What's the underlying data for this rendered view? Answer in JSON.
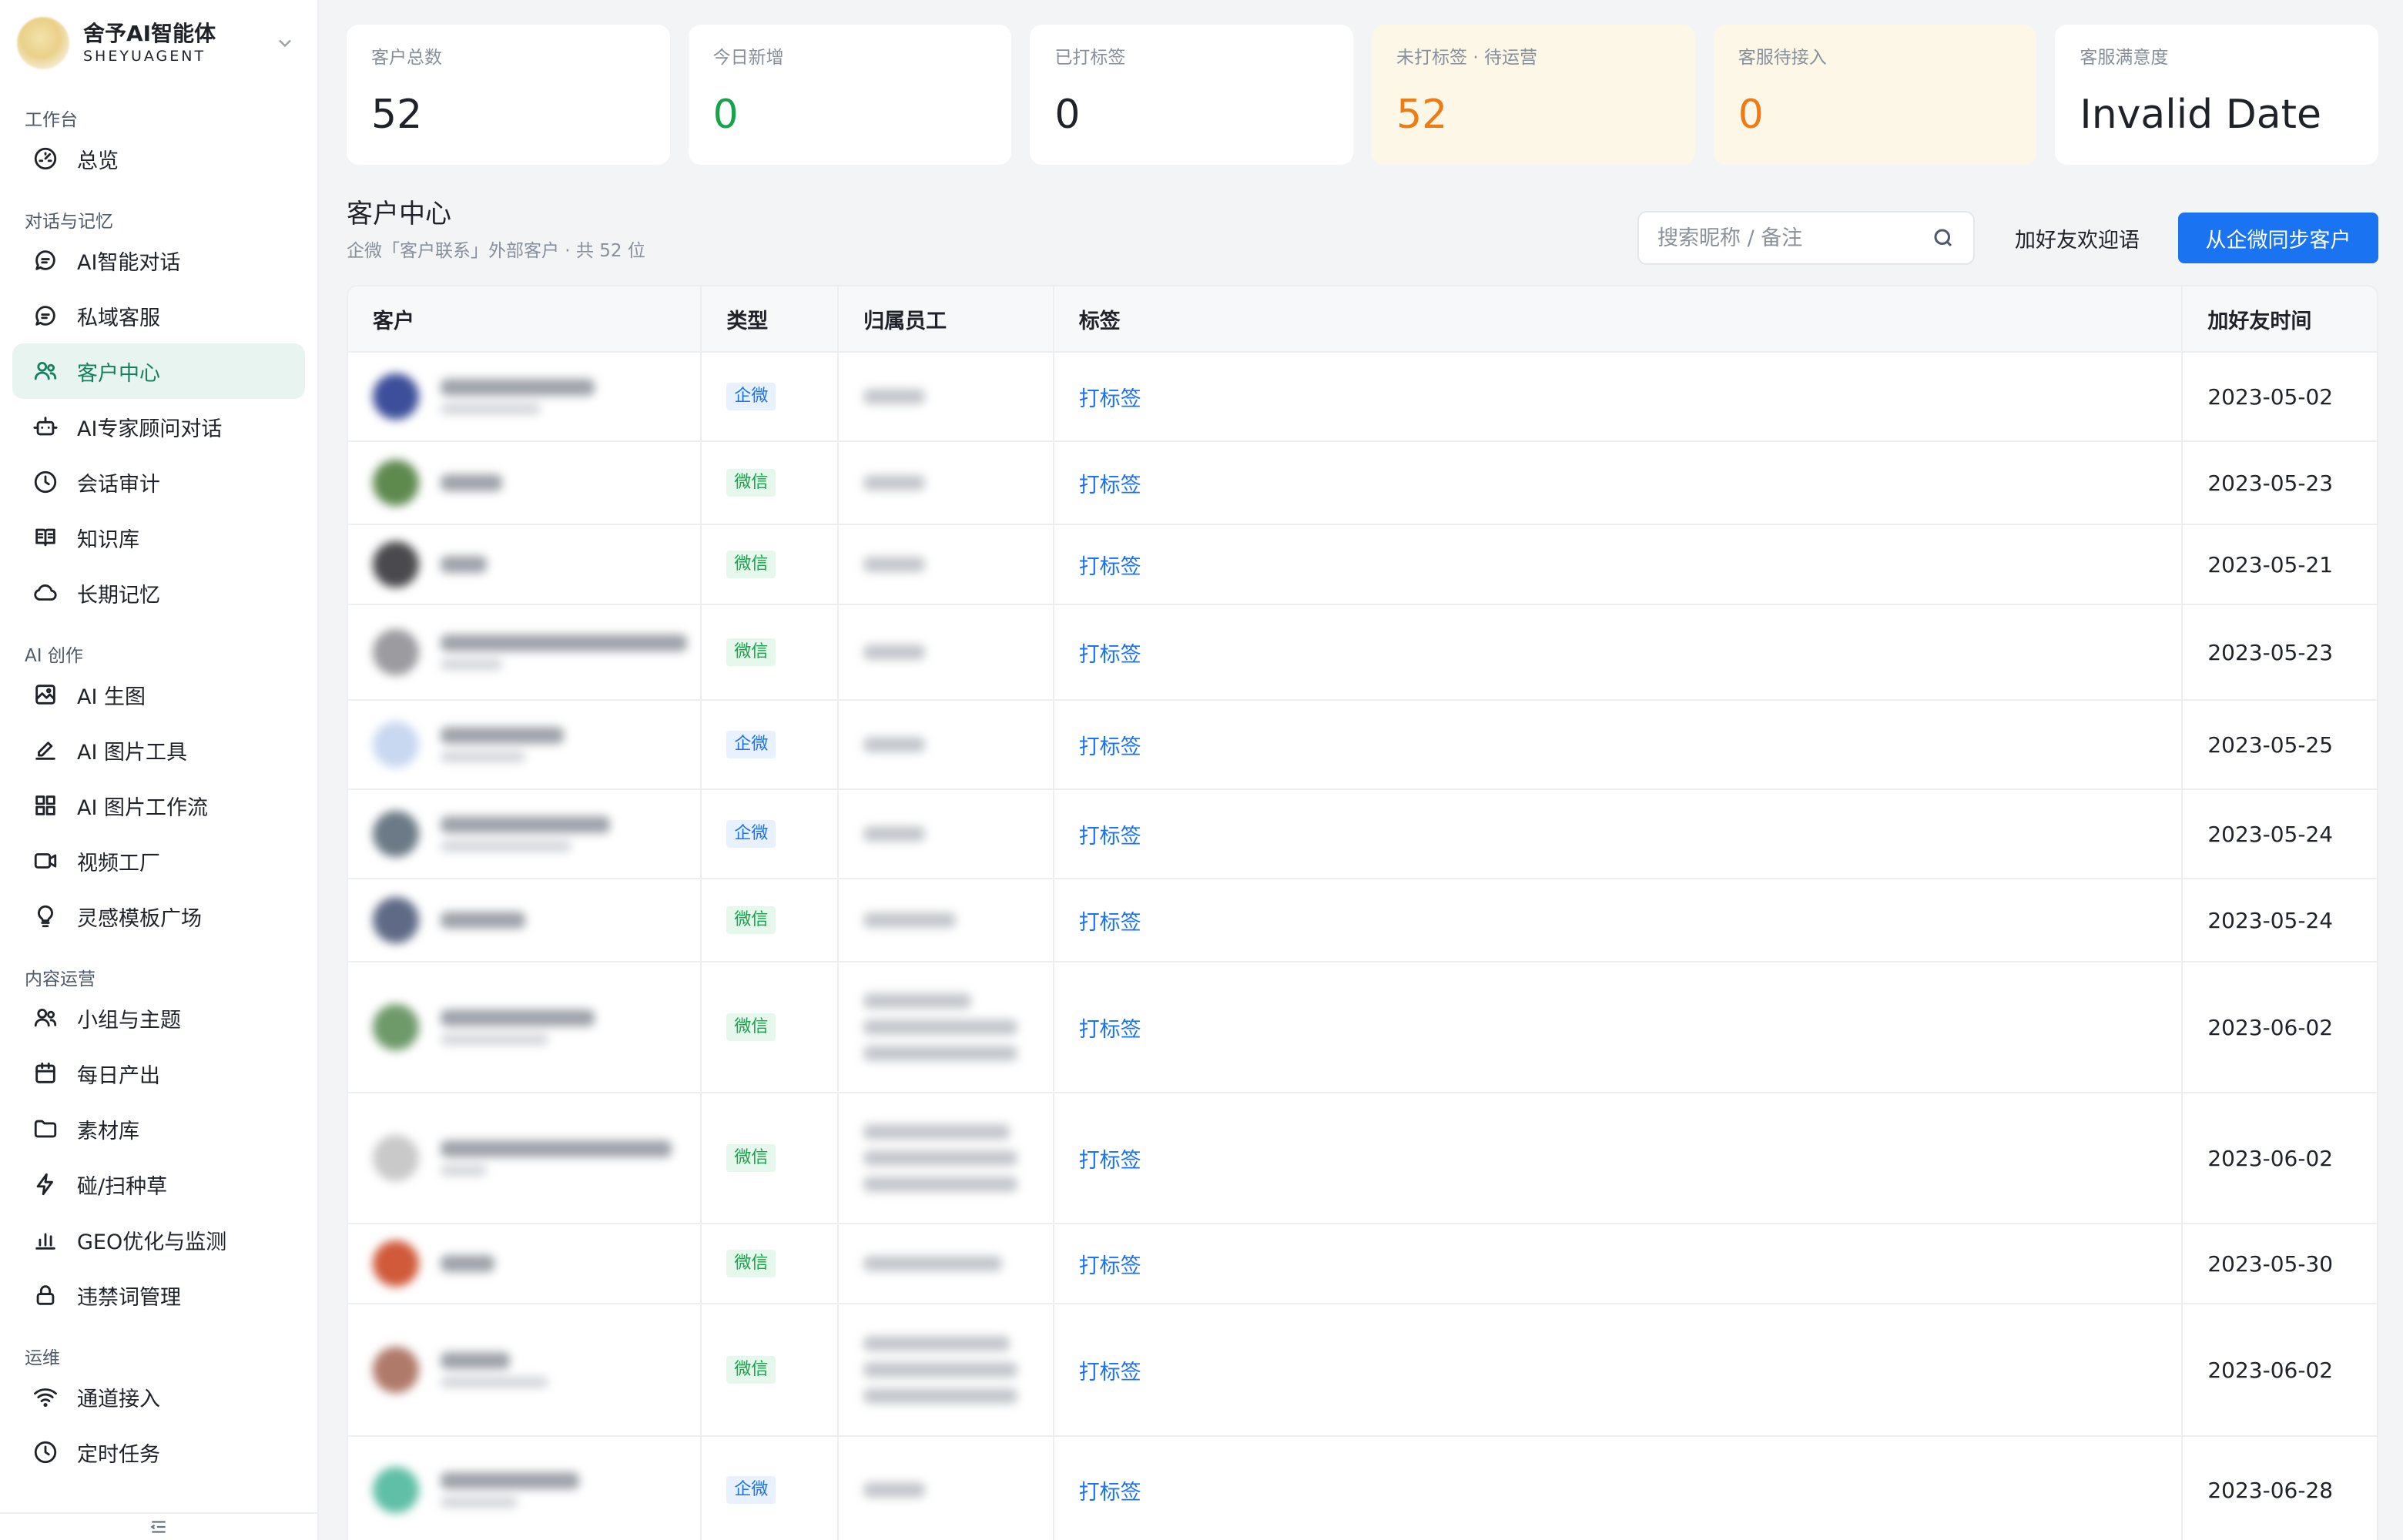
{
  "brand": {
    "name": "舍予AI智能体",
    "sub": "SHEYUAGENT",
    "chevron_icon": "chevron-down-icon"
  },
  "sidebar": {
    "sections": [
      {
        "title": "工作台",
        "items": [
          {
            "label": "总览",
            "icon": "dashboard-icon"
          }
        ]
      },
      {
        "title": "对话与记忆",
        "items": [
          {
            "label": "AI智能对话",
            "icon": "chat-icon"
          },
          {
            "label": "私域客服",
            "icon": "chat-icon"
          },
          {
            "label": "客户中心",
            "icon": "users-icon",
            "active": true
          },
          {
            "label": "AI专家顾问对话",
            "icon": "bot-icon"
          },
          {
            "label": "会话审计",
            "icon": "history-icon"
          },
          {
            "label": "知识库",
            "icon": "book-icon"
          },
          {
            "label": "长期记忆",
            "icon": "cloud-icon"
          }
        ]
      },
      {
        "title": "AI 创作",
        "items": [
          {
            "label": "AI 生图",
            "icon": "image-icon"
          },
          {
            "label": "AI 图片工具",
            "icon": "edit-icon"
          },
          {
            "label": "AI 图片工作流",
            "icon": "grid-icon"
          },
          {
            "label": "视频工厂",
            "icon": "video-icon"
          },
          {
            "label": "灵感模板广场",
            "icon": "bulb-icon"
          }
        ]
      },
      {
        "title": "内容运营",
        "items": [
          {
            "label": "小组与主题",
            "icon": "users-icon"
          },
          {
            "label": "每日产出",
            "icon": "calendar-icon"
          },
          {
            "label": "素材库",
            "icon": "folder-icon"
          },
          {
            "label": "碰/扫种草",
            "icon": "bolt-icon"
          },
          {
            "label": "GEO优化与监测",
            "icon": "bar-chart-icon"
          },
          {
            "label": "违禁词管理",
            "icon": "lock-icon"
          }
        ]
      },
      {
        "title": "运维",
        "items": [
          {
            "label": "通道接入",
            "icon": "wifi-icon"
          },
          {
            "label": "定时任务",
            "icon": "clock-icon"
          }
        ]
      }
    ]
  },
  "stats": [
    {
      "label": "客户总数",
      "value": "52",
      "tone": "default"
    },
    {
      "label": "今日新增",
      "value": "0",
      "tone": "green"
    },
    {
      "label": "已打标签",
      "value": "0",
      "tone": "default"
    },
    {
      "label": "未打标签 · 待运营",
      "value": "52",
      "tone": "orange"
    },
    {
      "label": "客服待接入",
      "value": "0",
      "tone": "orange"
    },
    {
      "label": "客服满意度",
      "value": "Invalid Date",
      "tone": "default"
    }
  ],
  "header": {
    "title": "客户中心",
    "subtitle": "企微「客户联系」外部客户 · 共 52 位",
    "search_placeholder": "搜索昵称 / 备注",
    "welcome_button": "加好友欢迎语",
    "sync_button": "从企微同步客户"
  },
  "table": {
    "columns": [
      "客户",
      "类型",
      "归属员工",
      "标签",
      "加好友时间"
    ],
    "tag_action": "打标签",
    "rows": [
      {
        "type": "企微",
        "date": "2023-05-02"
      },
      {
        "type": "微信",
        "date": "2023-05-23"
      },
      {
        "type": "微信",
        "date": "2023-05-21"
      },
      {
        "type": "微信",
        "date": "2023-05-23"
      },
      {
        "type": "企微",
        "date": "2023-05-25"
      },
      {
        "type": "企微",
        "date": "2023-05-24"
      },
      {
        "type": "微信",
        "date": "2023-05-24"
      },
      {
        "type": "微信",
        "date": "2023-06-02"
      },
      {
        "type": "微信",
        "date": "2023-06-02"
      },
      {
        "type": "微信",
        "date": "2023-05-30"
      },
      {
        "type": "微信",
        "date": "2023-06-02"
      },
      {
        "type": "企微",
        "date": "2023-06-28"
      }
    ]
  },
  "colors": {
    "accent": "#1a73f0",
    "active_bg": "#e7f4ef",
    "active_text": "#17805f",
    "green": "#16a34a",
    "orange": "#f07b12",
    "warn_card": "#fdf7e8"
  }
}
